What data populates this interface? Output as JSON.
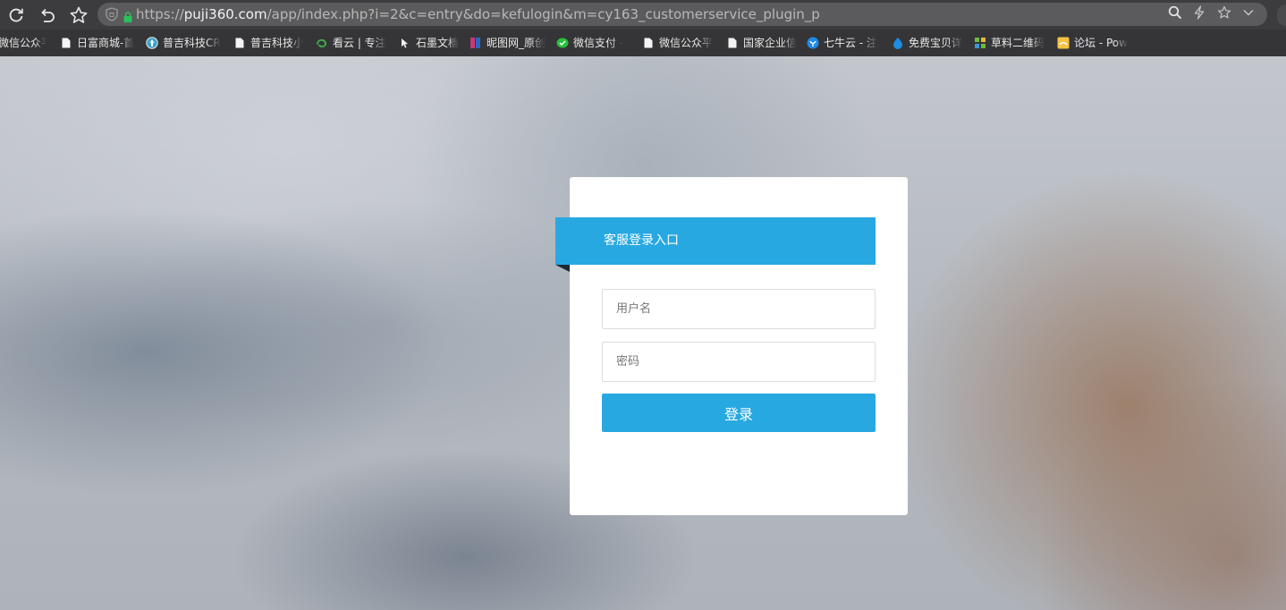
{
  "browser": {
    "url_prefix": "https://",
    "url_host": "puji360.com",
    "url_path": "/app/index.php?i=2&c=entry&do=kefulogin&m=cy163_customerservice_plugin_p"
  },
  "bookmarks": [
    {
      "label": "微信公众平",
      "icon": "none"
    },
    {
      "label": "日富商城-首",
      "icon": "page-icon"
    },
    {
      "label": "普吉科技CR",
      "icon": "globe-icon"
    },
    {
      "label": "普吉科技小",
      "icon": "page-icon"
    },
    {
      "label": "看云 | 专注",
      "icon": "kanyun-icon"
    },
    {
      "label": "石墨文档",
      "icon": "cursor-icon"
    },
    {
      "label": "昵图网_原创",
      "icon": "nipic-icon"
    },
    {
      "label": "微信支付 -",
      "icon": "wechat-icon"
    },
    {
      "label": "微信公众平",
      "icon": "page-icon"
    },
    {
      "label": "国家企业信",
      "icon": "page-icon"
    },
    {
      "label": "七牛云 - 注",
      "icon": "qiniu-icon"
    },
    {
      "label": "免费宝贝详",
      "icon": "drop-icon"
    },
    {
      "label": "草料二维码",
      "icon": "qrcode-icon"
    },
    {
      "label": "论坛 - Pow",
      "icon": "forum-icon"
    }
  ],
  "login": {
    "title": "客服登录入口",
    "username_placeholder": "用户名",
    "password_placeholder": "密码",
    "submit_label": "登录"
  },
  "colors": {
    "accent": "#28a8e0",
    "card": "#ffffff",
    "toolbar": "#3c3c3e",
    "bookmarks_bar": "#353537"
  }
}
